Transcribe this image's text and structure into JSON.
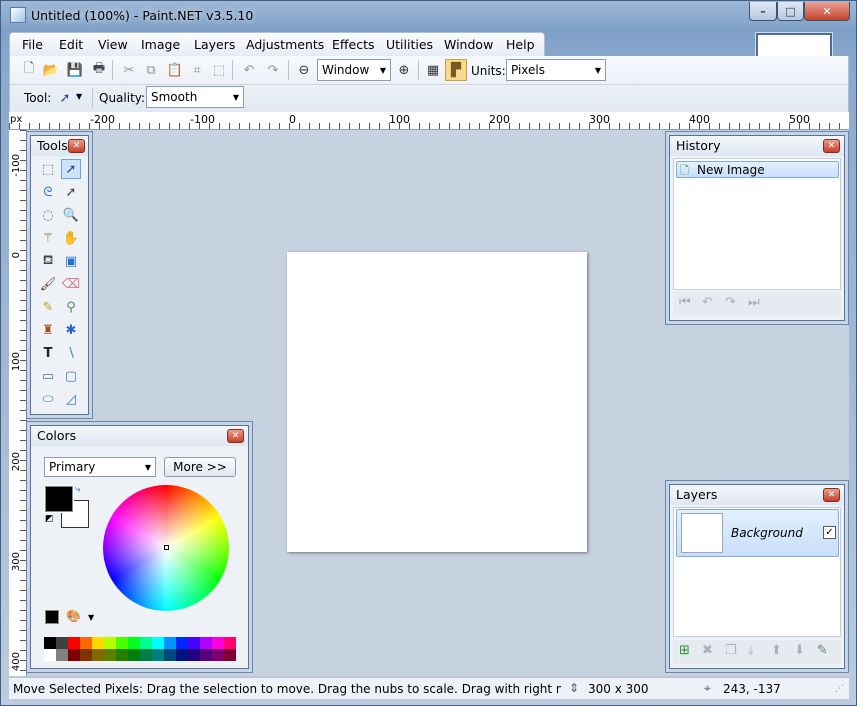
{
  "window": {
    "title": "Untitled (100%) - Paint.NET v3.5.10",
    "minimize": "–",
    "maximize": "□",
    "close": "✕"
  },
  "menu": [
    "File",
    "Edit",
    "View",
    "Image",
    "Layers",
    "Adjustments",
    "Effects",
    "Utilities",
    "Window",
    "Help"
  ],
  "toolbar": {
    "zoom_value": "Window",
    "units_label": "Units:",
    "units_value": "Pixels",
    "tool_label": "Tool:",
    "quality_label": "Quality:",
    "quality_value": "Smooth"
  },
  "ruler": {
    "unit": "px",
    "h_ticks": [
      "-200",
      "-100",
      "0",
      "100",
      "200",
      "300",
      "400",
      "500"
    ],
    "v_ticks": [
      "-100",
      "0",
      "100",
      "200",
      "300",
      "400"
    ]
  },
  "tools_panel": {
    "title": "Tools",
    "icons": [
      "rectangle-select-icon",
      "move-selected-pixels-icon",
      "lasso-select-icon",
      "move-selection-icon",
      "ellipse-select-icon",
      "zoom-icon",
      "magic-wand-icon",
      "pan-icon",
      "paint-bucket-icon",
      "gradient-icon",
      "paintbrush-icon",
      "eraser-icon",
      "pencil-icon",
      "color-picker-icon",
      "clone-stamp-icon",
      "recolor-icon",
      "text-icon",
      "line-curve-icon",
      "rectangle-icon",
      "rounded-rectangle-icon",
      "ellipse-icon",
      "freeform-shape-icon"
    ]
  },
  "history_panel": {
    "title": "History",
    "items": [
      "New Image"
    ]
  },
  "colors_panel": {
    "title": "Colors",
    "mode": "Primary",
    "more_label": "More >>",
    "primary": "#000000",
    "secondary": "#ffffff"
  },
  "layers_panel": {
    "title": "Layers",
    "layers": [
      {
        "name": "Background",
        "visible": true
      }
    ]
  },
  "status": {
    "hint": "Move Selected Pixels: Drag the selection to move. Drag the nubs to scale. Drag with right mouse button t",
    "size": "300 x 300",
    "coords": "243, -137"
  },
  "palette": [
    "#000000",
    "#404040",
    "#ff0000",
    "#ff6a00",
    "#ffd800",
    "#b6ff00",
    "#4cff00",
    "#00ff21",
    "#00ff90",
    "#00ffff",
    "#0094ff",
    "#0026ff",
    "#4800ff",
    "#b200ff",
    "#ff00dc",
    "#ff006e",
    "#ffffff",
    "#808080",
    "#7f0000",
    "#7f3300",
    "#7f6a00",
    "#5b7f00",
    "#267f00",
    "#007f0e",
    "#007f46",
    "#007f7f",
    "#004a7f",
    "#00137f",
    "#21007f",
    "#57007f",
    "#7f006e",
    "#7f0037"
  ]
}
